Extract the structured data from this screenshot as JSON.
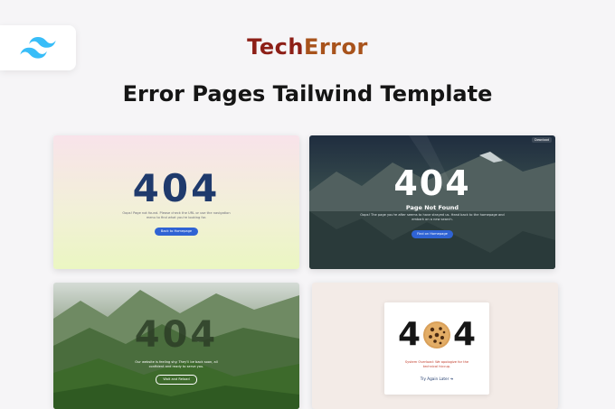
{
  "brand": {
    "part1": "Tech",
    "part2": "Error"
  },
  "title": "Error Pages Tailwind Template",
  "logo": {
    "icon": "tailwind-logo-icon",
    "color": "#38bdf8"
  },
  "cards": [
    {
      "code": "404",
      "message": "Oops! Page not found. Please check the URL or use the navigation menu to find what you're looking for.",
      "button": "Back to Homepage"
    },
    {
      "tag": "Download",
      "code": "404",
      "subtitle": "Page Not Found",
      "message": "Oops! The page you're after seems to have strayed us. Head back to the homepage and embark on a new search.",
      "button": "Find on Homepage"
    },
    {
      "code": "404",
      "message": "Our website is feeling shy. They'll be back soon, all confident and ready to serve you.",
      "button": "Wait and Reload"
    },
    {
      "digit_left": "4",
      "digit_right": "4",
      "message": "System Overload: We apologize for the technical hiccup.",
      "link": "Try Again Later ➔"
    }
  ],
  "colors": {
    "brand_dark": "#8d1f17",
    "brand_light": "#a8531c",
    "button_blue": "#2f63d4"
  }
}
